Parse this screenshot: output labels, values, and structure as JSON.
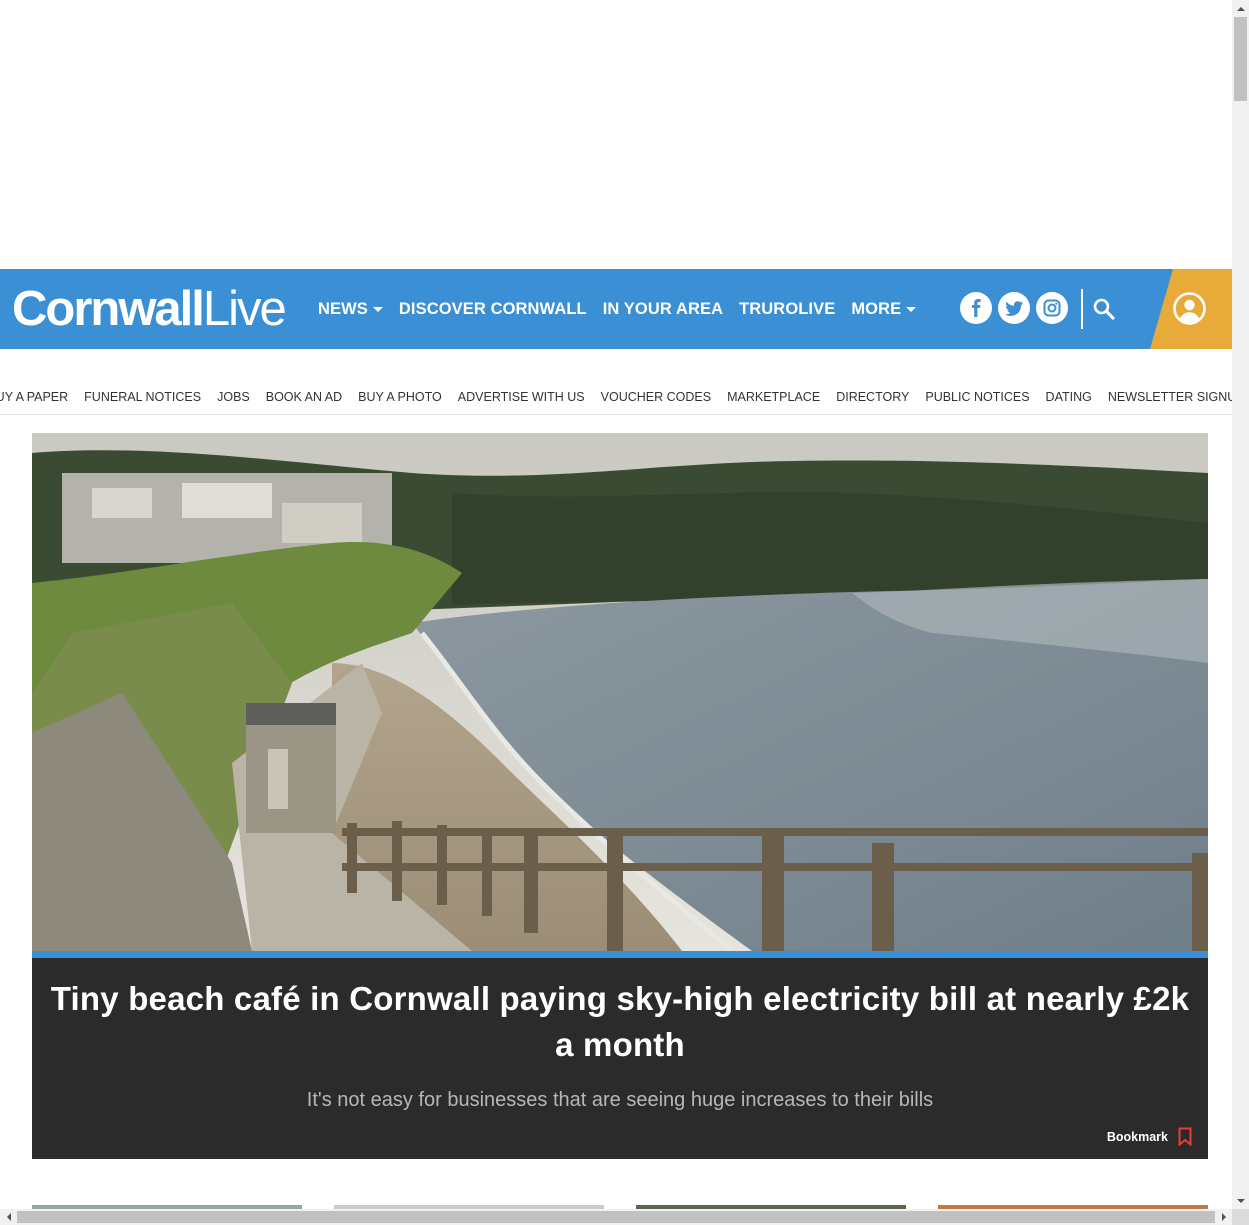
{
  "brand": {
    "logo_part1": "Cornwall",
    "logo_part2": "Live",
    "header_color": "#3b8fd4",
    "account_color": "#e8aa38",
    "hero_bg_color": "#2b2b2b"
  },
  "primary_nav": {
    "items": [
      {
        "label": "NEWS",
        "has_dropdown": true
      },
      {
        "label": "DISCOVER CORNWALL",
        "has_dropdown": false
      },
      {
        "label": "IN YOUR AREA",
        "has_dropdown": false
      },
      {
        "label": "TRUROLIVE",
        "has_dropdown": false
      },
      {
        "label": "MORE",
        "has_dropdown": true
      }
    ]
  },
  "header_icons": [
    "facebook-icon",
    "twitter-icon",
    "instagram-icon",
    "search-icon",
    "account-icon"
  ],
  "secondary_nav": {
    "items": [
      "BUY A PAPER",
      "FUNERAL NOTICES",
      "JOBS",
      "BOOK AN AD",
      "BUY A PHOTO",
      "ADVERTISE WITH US",
      "VOUCHER CODES",
      "MARKETPLACE",
      "DIRECTORY",
      "PUBLIC NOTICES",
      "DATING",
      "NEWSLETTER SIGNUP"
    ]
  },
  "hero": {
    "title": "Tiny beach café in Cornwall paying sky-high electricity bill at nearly £2k a month",
    "subtitle": "It's not easy for businesses that are seeing huge increases to their bills",
    "bookmark_label": "Bookmark",
    "image_subject": "coastal-beach-path-photo"
  }
}
